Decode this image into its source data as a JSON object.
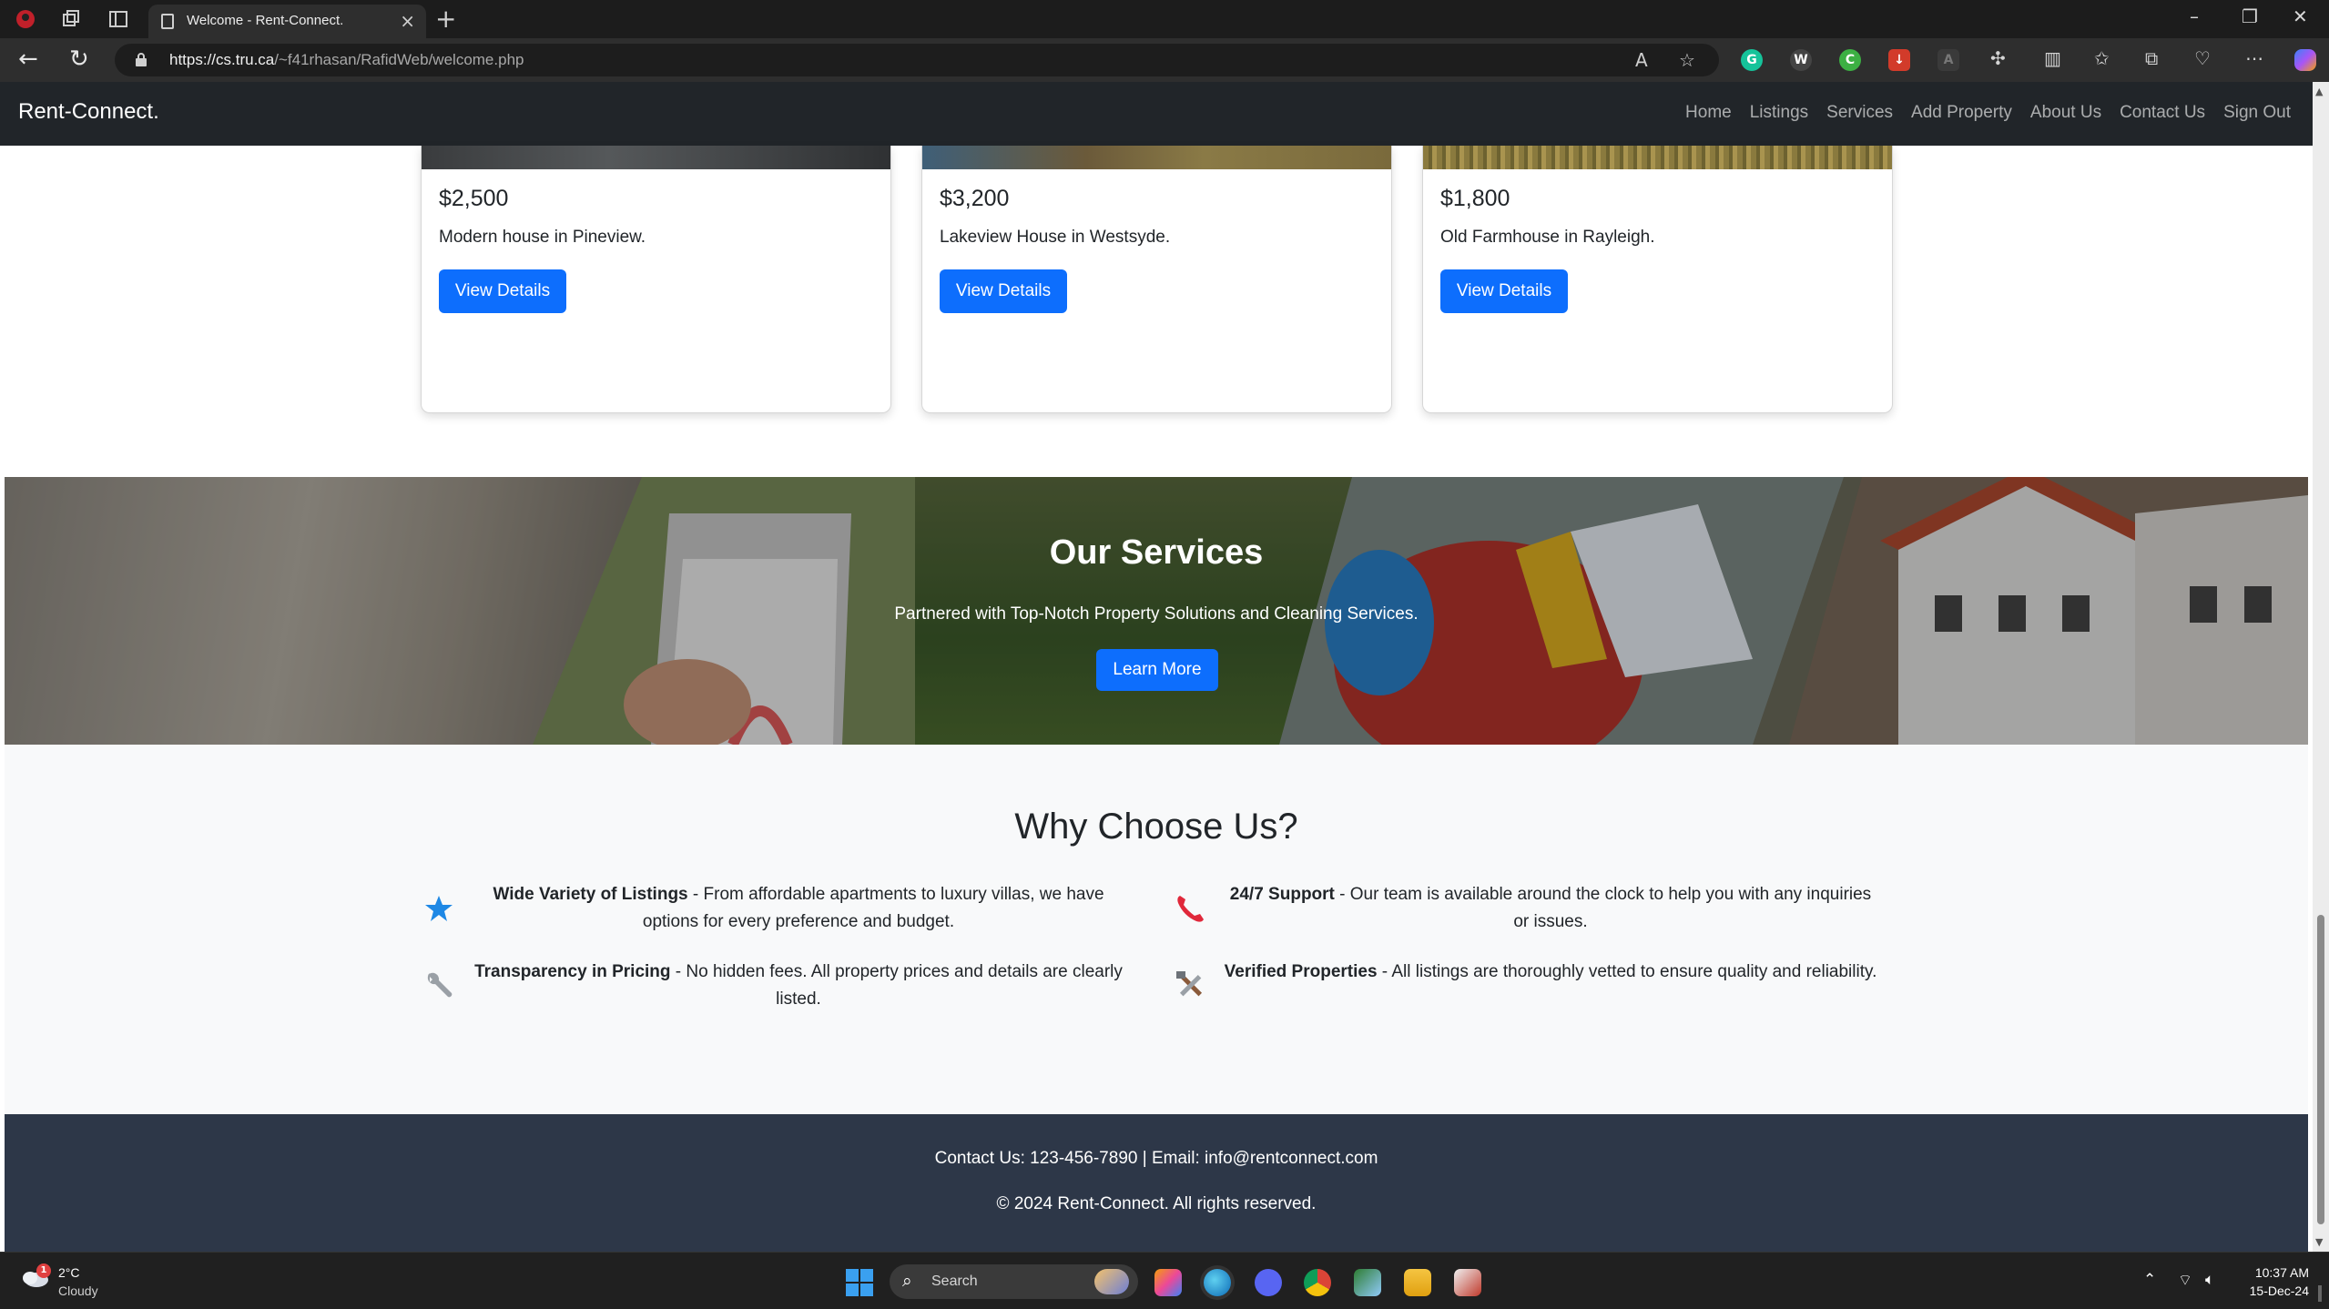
{
  "browser": {
    "tab_title": "Welcome - Rent-Connect.",
    "url_host": "https://cs.tru.ca",
    "url_path": "/~f41rhasan/RafidWeb/welcome.php"
  },
  "site": {
    "brand": "Rent-Connect.",
    "nav": [
      "Home",
      "Listings",
      "Services",
      "Add Property",
      "About Us",
      "Contact Us",
      "Sign Out"
    ]
  },
  "listings": [
    {
      "price": "$2,500",
      "description": "Modern house in Pineview.",
      "button": "View Details"
    },
    {
      "price": "$3,200",
      "description": "Lakeview House in Westsyde.",
      "button": "View Details"
    },
    {
      "price": "$1,800",
      "description": "Old Farmhouse in Rayleigh.",
      "button": "View Details"
    }
  ],
  "services": {
    "title": "Our Services",
    "subtitle": "Partnered with Top-Notch Property Solutions and Cleaning Services.",
    "button": "Learn More"
  },
  "why": {
    "title": "Why Choose Us?",
    "features": [
      {
        "icon": "star-icon",
        "title": "Wide Variety of Listings",
        "text": " - From affordable apartments to luxury villas, we have options for every preference and budget."
      },
      {
        "icon": "phone-icon",
        "title": "24/7 Support",
        "text": " - Our team is available around the clock to help you with any inquiries or issues."
      },
      {
        "icon": "wrench-icon",
        "title": "Transparency in Pricing",
        "text": " - No hidden fees. All property prices and details are clearly listed."
      },
      {
        "icon": "tools-icon",
        "title": "Verified Properties",
        "text": " - All listings are thoroughly vetted to ensure quality and reliability."
      }
    ]
  },
  "footer": {
    "contact": "Contact Us: 123-456-7890 | Email: info@rentconnect.com",
    "copyright": "© 2024 Rent-Connect. All rights reserved."
  },
  "taskbar": {
    "weather_badge": "1",
    "temperature": "2°C",
    "condition": "Cloudy",
    "search_label": "Search",
    "time": "10:37 AM",
    "date": "15-Dec-24"
  },
  "colors": {
    "primary": "#0d6efd",
    "navbar": "#212529",
    "footer": "#2d3748",
    "section_bg": "#f8f9fa"
  }
}
